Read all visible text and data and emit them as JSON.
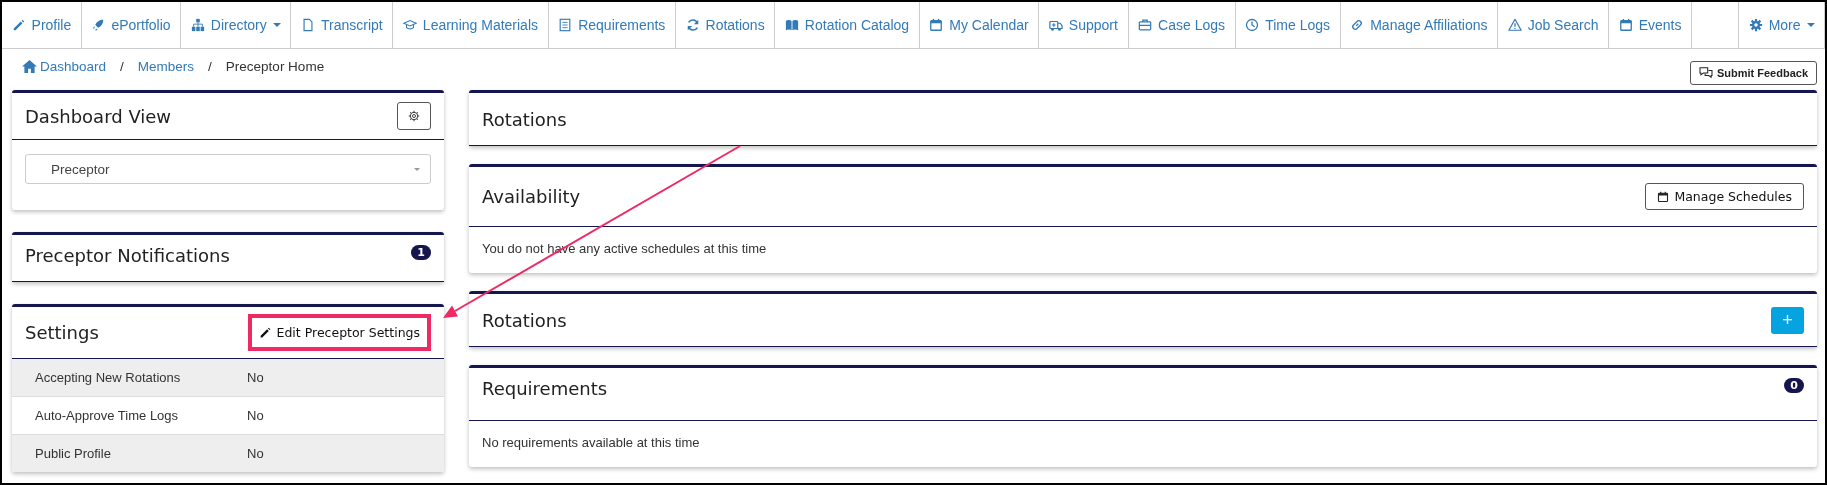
{
  "nav": [
    {
      "kind": "link",
      "label": "Profile",
      "dropdown": false
    },
    {
      "kind": "link",
      "label": "ePortfolio",
      "dropdown": false
    },
    {
      "kind": "link",
      "label": "Directory",
      "dropdown": true
    },
    {
      "kind": "link",
      "label": "Transcript",
      "dropdown": false
    },
    {
      "kind": "link",
      "label": "Learning Materials",
      "dropdown": false
    },
    {
      "kind": "link",
      "label": "Requirements",
      "dropdown": false
    },
    {
      "kind": "link",
      "label": "Rotations",
      "dropdown": false
    },
    {
      "kind": "link",
      "label": "Rotation Catalog",
      "dropdown": false
    },
    {
      "kind": "link",
      "label": "My Calendar",
      "dropdown": false
    },
    {
      "kind": "link",
      "label": "Support",
      "dropdown": false
    },
    {
      "kind": "link",
      "label": "Case Logs",
      "dropdown": false
    },
    {
      "kind": "link",
      "label": "Time Logs",
      "dropdown": false
    },
    {
      "kind": "link",
      "label": "Manage Affiliations",
      "dropdown": false
    },
    {
      "kind": "link",
      "label": "Job Search",
      "dropdown": false
    },
    {
      "kind": "link",
      "label": "Events",
      "dropdown": false
    },
    {
      "kind": "spacer"
    },
    {
      "kind": "link",
      "label": "More",
      "dropdown": true
    }
  ],
  "breadcrumb": [
    {
      "label": "Dashboard",
      "link": true,
      "separator": "/"
    },
    {
      "label": "Members",
      "link": true,
      "separator": "/"
    },
    {
      "label": "Preceptor Home",
      "link": false
    }
  ],
  "submit_feedback": "Submit Feedback",
  "dashboard_view": {
    "title": "Dashboard View",
    "select_value": "Preceptor"
  },
  "notifications": {
    "title": "Preceptor Notifications",
    "badge": "1"
  },
  "settings": {
    "title": "Settings",
    "edit_button": "Edit Preceptor Settings",
    "rows": [
      {
        "label": "Accepting New Rotations",
        "value": "No"
      },
      {
        "label": "Auto-Approve Time Logs",
        "value": "No"
      },
      {
        "label": "Public Profile",
        "value": "No"
      }
    ]
  },
  "rotations_top": {
    "title": "Rotations"
  },
  "availability": {
    "title": "Availability",
    "button": "Manage Schedules",
    "message": "You do not have any active schedules at this time"
  },
  "rotations": {
    "title": "Rotations",
    "add_button": "+"
  },
  "requirements": {
    "title": "Requirements",
    "badge": "0",
    "message": "No requirements available at this time"
  },
  "annotations": {
    "highlight_box": true,
    "arrow": true
  }
}
